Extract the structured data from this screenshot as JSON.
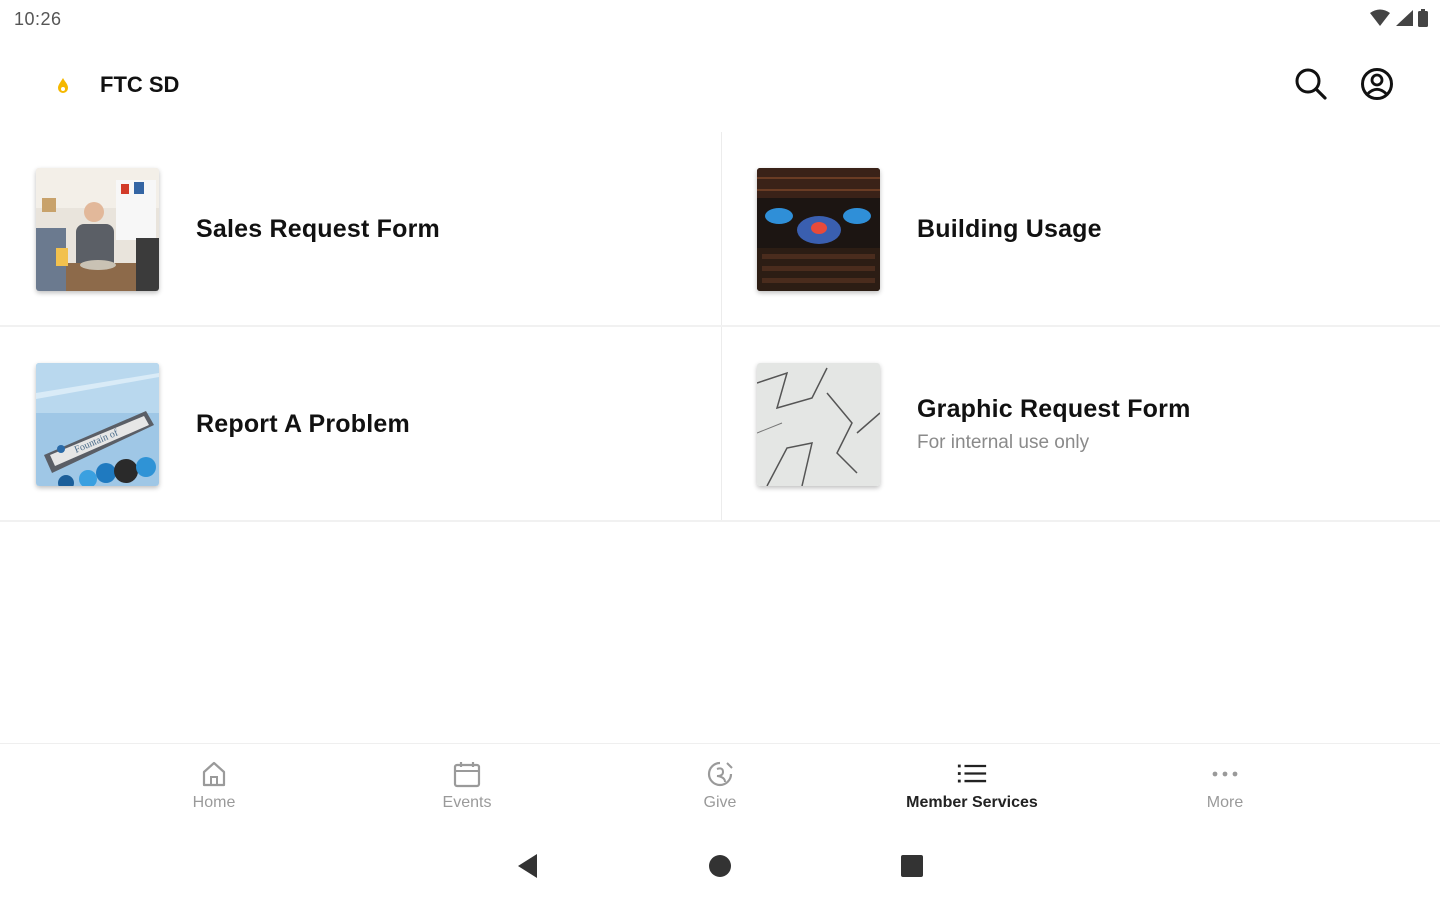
{
  "status_bar": {
    "time": "10:26",
    "icons": [
      "wifi-icon",
      "cell-signal-icon",
      "battery-icon"
    ]
  },
  "app_bar": {
    "title": "FTC SD",
    "logo_icon": "flame-logo-icon",
    "accent_color": "#f5b800",
    "actions": [
      "search-icon",
      "account-icon"
    ]
  },
  "cards": [
    {
      "title": "Sales Request Form",
      "subtitle": "",
      "thumb": "person-serving-food-photo"
    },
    {
      "title": "Building Usage",
      "subtitle": "",
      "thumb": "auditorium-stage-photo"
    },
    {
      "title": "Report A Problem",
      "subtitle": "",
      "thumb": "church-sign-photo"
    },
    {
      "title": "Graphic Request Form",
      "subtitle": "For internal use only",
      "thumb": "cracked-surface-photo"
    }
  ],
  "bottom_nav": {
    "items": [
      {
        "label": "Home",
        "icon": "home-icon",
        "active": false
      },
      {
        "label": "Events",
        "icon": "calendar-icon",
        "active": false
      },
      {
        "label": "Give",
        "icon": "give-icon",
        "active": false
      },
      {
        "label": "Member Services",
        "icon": "list-icon",
        "active": true
      },
      {
        "label": "More",
        "icon": "more-icon",
        "active": false
      }
    ]
  },
  "system_nav": [
    "back-icon",
    "home-circle-icon",
    "recents-icon"
  ]
}
